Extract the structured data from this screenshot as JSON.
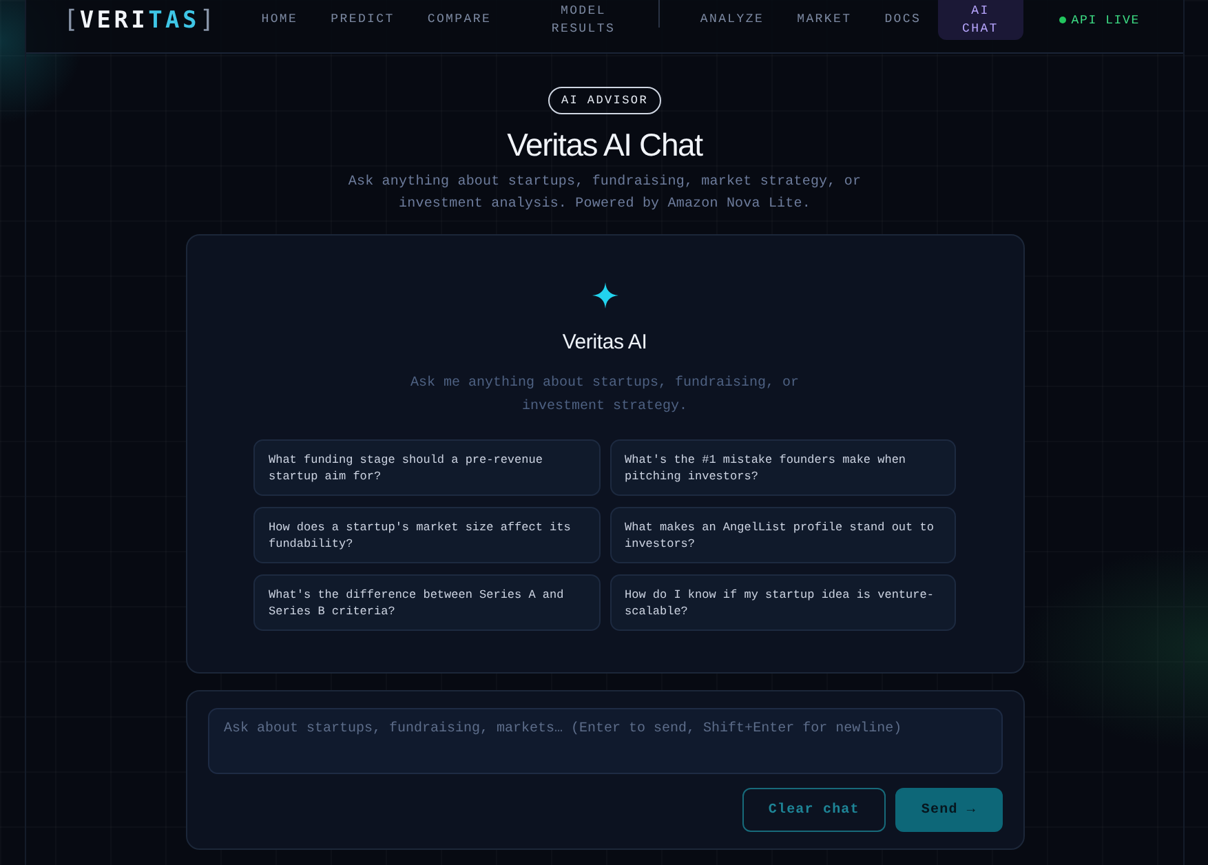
{
  "header": {
    "logo": {
      "open": "[",
      "main": "VERI",
      "accent": "TAS",
      "close": "]"
    },
    "nav_groups": [
      {
        "items": [
          {
            "label": "HOME",
            "selected": false
          },
          {
            "label": "PREDICT",
            "selected": false
          },
          {
            "label": "COMPARE",
            "selected": false
          },
          {
            "label": "MODEL RESULTS",
            "selected": false
          }
        ]
      },
      {
        "items": [
          {
            "label": "ANALYZE",
            "selected": false
          },
          {
            "label": "MARKET",
            "selected": false
          },
          {
            "label": "DOCS",
            "selected": false
          },
          {
            "label": "AI CHAT",
            "selected": true
          }
        ]
      }
    ],
    "status": {
      "label": "API LIVE",
      "online": true
    }
  },
  "hero": {
    "badge": "AI ADVISOR",
    "title": "Veritas AI Chat",
    "subtitle": "Ask anything about startups, fundraising, market strategy, or investment analysis. Powered by Amazon Nova Lite."
  },
  "chat": {
    "assistant_name": "Veritas AI",
    "intro": "Ask me anything about startups, fundraising, or investment strategy.",
    "suggestions": [
      "What funding stage should a pre-revenue startup aim for?",
      "What's the #1 mistake founders make when pitching investors?",
      "How does a startup's market size affect its fundability?",
      "What makes an AngelList profile stand out to investors?",
      "What's the difference between Series A and Series B criteria?",
      "How do I know if my startup idea is venture-scalable?"
    ]
  },
  "composer": {
    "placeholder": "Ask about startups, fundraising, markets… (Enter to send, Shift+Enter for newline)",
    "buttons": [
      {
        "label": "Clear chat",
        "kind": "secondary"
      },
      {
        "label": "Send →",
        "kind": "primary"
      }
    ]
  }
}
